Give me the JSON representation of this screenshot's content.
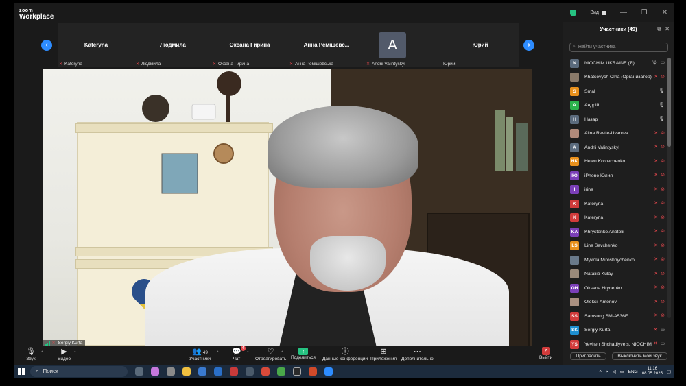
{
  "app": {
    "logo_line1": "zoom",
    "logo_line2": "Workplace"
  },
  "titlebar": {
    "view_label": "Вид",
    "minimize": "—",
    "maximize": "❐",
    "close": "✕"
  },
  "strip": {
    "tiles": [
      {
        "name": "Kateryna",
        "label": "Kateryna"
      },
      {
        "name": "Людмила",
        "label": "Людмила"
      },
      {
        "name": "Оксана Гирина",
        "label": "Оксана Гирина"
      },
      {
        "name": "Анна Ремішевс...",
        "label": "Анна Ремішевська"
      },
      {
        "name": "",
        "avatar": "A",
        "label": "Andrii Valintyskyi"
      },
      {
        "name": "Юрий",
        "label": "Юрий"
      }
    ],
    "prev": "‹",
    "next": "›"
  },
  "main_video": {
    "name": "Sergiy Kurta"
  },
  "toolbar": {
    "audio": "Звук",
    "video": "Видео",
    "participants": "Участники",
    "participants_count": "49",
    "chat": "Чат",
    "chat_badge": "4",
    "react": "Отреагировать",
    "share": "Поделиться",
    "meeting_info": "Данные конференции",
    "apps": "Приложения",
    "more": "Дополнительно",
    "leave": "Выйти"
  },
  "panel": {
    "title": "Участники (49)",
    "search_placeholder": "Найти участника",
    "participants": [
      {
        "initials": "N",
        "color": "#5b6b7d",
        "name": "NIOCHIM UKRAINE (Я)",
        "mic": "on",
        "video": "cam"
      },
      {
        "initials": "",
        "color": "#8a7a6a",
        "name": "Khatsevych Olha (Организатор)",
        "mic": "off",
        "video": "off"
      },
      {
        "initials": "S",
        "color": "#e8901c",
        "name": "Smal",
        "mic": "on",
        "video": ""
      },
      {
        "initials": "A",
        "color": "#2bb24c",
        "name": "Андрій",
        "mic": "on",
        "video": ""
      },
      {
        "initials": "H",
        "color": "#5b6b7d",
        "name": "Назар",
        "mic": "on",
        "video": ""
      },
      {
        "initials": "",
        "color": "#b08a7a",
        "name": "Alina Revtie-Uvarova",
        "mic": "off",
        "video": "off"
      },
      {
        "initials": "A",
        "color": "#5b6b7d",
        "name": "Andrii Valintyskyi",
        "mic": "off",
        "video": "off"
      },
      {
        "initials": "HK",
        "color": "#e8901c",
        "name": "Helen Korovchenko",
        "mic": "off",
        "video": "off"
      },
      {
        "initials": "IЮ",
        "color": "#7b3fb8",
        "name": "iPhone Юлия",
        "mic": "off",
        "video": "off"
      },
      {
        "initials": "I",
        "color": "#7b3fb8",
        "name": "irina",
        "mic": "off",
        "video": "off"
      },
      {
        "initials": "K",
        "color": "#d13b3b",
        "name": "Kateryna",
        "mic": "off",
        "video": "off"
      },
      {
        "initials": "K",
        "color": "#d13b3b",
        "name": "Kateryna",
        "mic": "off",
        "video": "off"
      },
      {
        "initials": "KA",
        "color": "#7b3fb8",
        "name": "Khrystenko Anatolii",
        "mic": "off",
        "video": "off"
      },
      {
        "initials": "LS",
        "color": "#e8901c",
        "name": "Lina Savchenko",
        "mic": "off",
        "video": "off"
      },
      {
        "initials": "",
        "color": "#6a7a8a",
        "name": "Mykola Miroshnychenko",
        "mic": "off",
        "video": "off"
      },
      {
        "initials": "",
        "color": "#9a8a7a",
        "name": "Nataliia Kulay",
        "mic": "off",
        "video": "off"
      },
      {
        "initials": "OH",
        "color": "#7b3fb8",
        "name": "Oksana Hrynenko",
        "mic": "off",
        "video": "off"
      },
      {
        "initials": "",
        "color": "#aa9080",
        "name": "Oleksii Antonov",
        "mic": "off",
        "video": "off"
      },
      {
        "initials": "SS",
        "color": "#d13b3b",
        "name": "Samsung SM-A536E",
        "mic": "off",
        "video": "off"
      },
      {
        "initials": "SK",
        "color": "#1e8fd0",
        "name": "Sergiy Kurta",
        "mic": "off",
        "video": "cam"
      },
      {
        "initials": "YS",
        "color": "#d13b3b",
        "name": "Yevhen Shchadlyvets, NIOCHIM",
        "mic": "off",
        "video": "cam"
      }
    ],
    "invite": "Пригласить",
    "unmute": "Выключить мой звук"
  },
  "taskbar": {
    "search": "Поиск",
    "lang": "ENG",
    "time": "11:16",
    "date": "08.05.2025"
  }
}
